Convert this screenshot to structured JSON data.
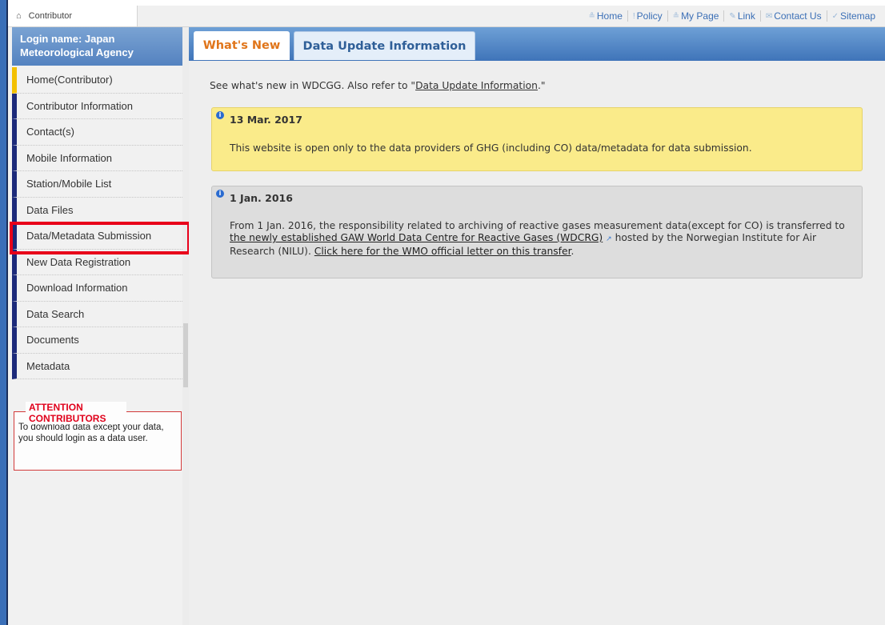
{
  "topbar": {
    "section_label": "Contributor",
    "links": [
      {
        "icon": "person-icon",
        "glyph": "≗",
        "label": "Home"
      },
      {
        "icon": "exclaim-icon",
        "glyph": "!",
        "label": "Policy"
      },
      {
        "icon": "user-icon",
        "glyph": "≗",
        "label": "My Page"
      },
      {
        "icon": "pencil-icon",
        "glyph": "✎",
        "label": "Link"
      },
      {
        "icon": "mail-icon",
        "glyph": "✉",
        "label": "Contact Us"
      },
      {
        "icon": "check-icon",
        "glyph": "✓",
        "label": "Sitemap"
      }
    ]
  },
  "sidebar": {
    "login_text": "Login name: Japan Meteorological Agency",
    "items": [
      {
        "label": "Home(Contributor)",
        "active": true
      },
      {
        "label": "Contributor Information"
      },
      {
        "label": "Contact(s)"
      },
      {
        "label": "Mobile Information"
      },
      {
        "label": "Station/Mobile List"
      },
      {
        "label": "Data Files"
      },
      {
        "label": "Data/Metadata Submission"
      },
      {
        "label": "New Data Registration"
      },
      {
        "label": "Download Information"
      },
      {
        "label": "Data Search"
      },
      {
        "label": "Documents"
      },
      {
        "label": "Metadata"
      }
    ],
    "attention_title": "ATTENTION CONTRIBUTORS",
    "attention_text": "To download data except your data, you should login as a data user."
  },
  "tabs": [
    {
      "label": "What's New",
      "active": true
    },
    {
      "label": "Data Update Information",
      "active": false
    }
  ],
  "content": {
    "intro_prefix": "See what's new in WDCGG. Also refer to \"",
    "intro_link": "Data Update Information",
    "intro_suffix": ".\"",
    "notices": [
      {
        "date": "13 Mar. 2017",
        "body": "This website is open only to the data providers of GHG (including CO) data/metadata for data submission."
      },
      {
        "date": "1 Jan. 2016",
        "body_prefix": "From 1 Jan. 2016, the responsibility related to archiving of reactive gases measurement data(except for CO) is transferred to ",
        "link1": "the newly established GAW World Data Centre for Reactive Gases (WDCRG)",
        "body_mid": " hosted by the Norwegian Institute for Air Research (NILU). ",
        "link2": "Click here for the WMO official letter on this transfer",
        "body_suffix": "."
      }
    ]
  },
  "colors": {
    "accent_blue": "#3f74b9",
    "menu_marker": "#1c2a7a",
    "active_marker": "#f3c000",
    "highlight_red": "#e8001a",
    "notice_yellow": "#faeb8a",
    "notice_gray": "#dddddd"
  }
}
